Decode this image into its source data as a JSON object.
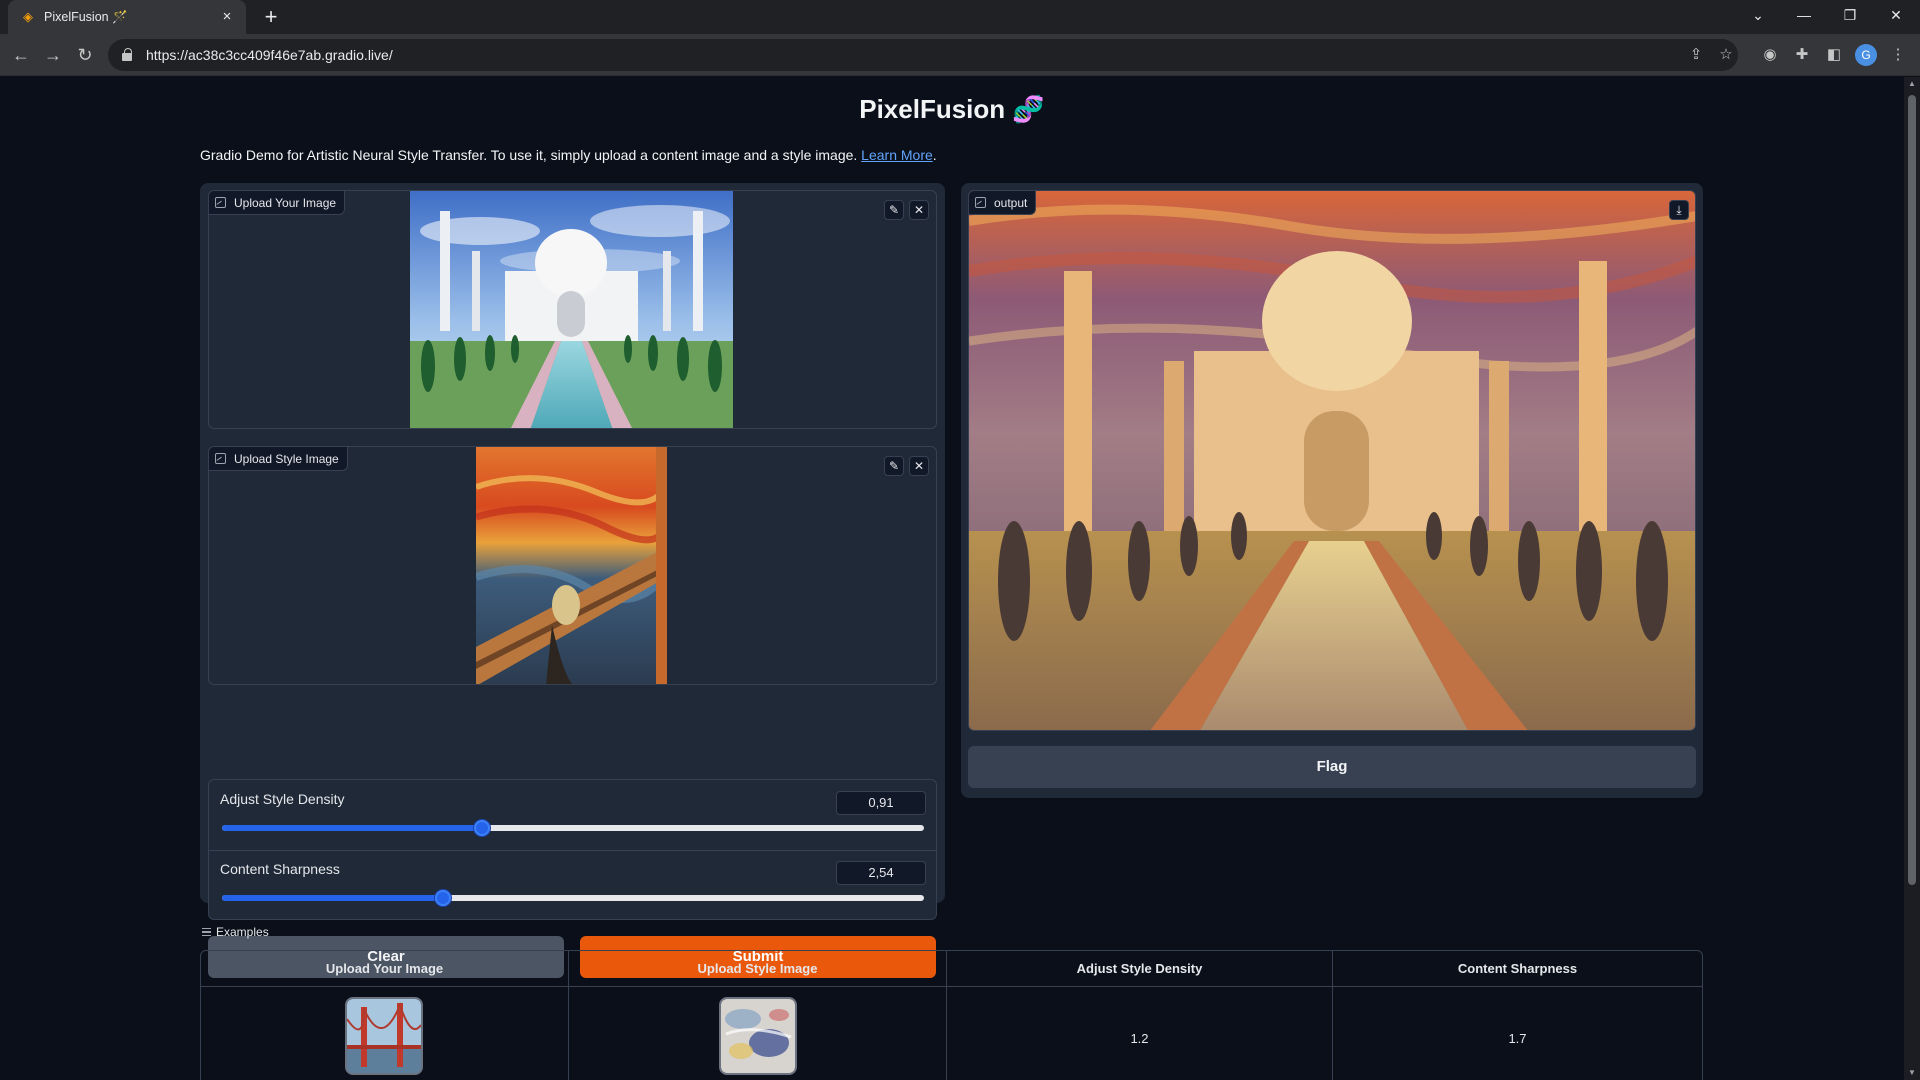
{
  "browser": {
    "tab_title": "PixelFusion 🪄",
    "url": "https://ac38c3cc409f46e7ab.gradio.live/",
    "new_tab_label": "+",
    "profile_initial": "G"
  },
  "page": {
    "title": "PixelFusion 🧬",
    "description": "Gradio Demo for Artistic Neural Style Transfer. To use it, simply upload a content image and a style image.",
    "learn_more": "Learn More",
    "period": "."
  },
  "inputs": {
    "content_image_label": "Upload Your Image",
    "style_image_label": "Upload Style Image",
    "edit_icon": "✎",
    "clear_icon": "✕"
  },
  "sliders": [
    {
      "label": "Adjust Style Density",
      "value": "0,91",
      "fraction": 0.37
    },
    {
      "label": "Content Sharpness",
      "value": "2,54",
      "fraction": 0.315
    }
  ],
  "buttons": {
    "clear": "Clear",
    "submit": "Submit",
    "flag": "Flag"
  },
  "output": {
    "label": "output",
    "download_icon": "⤓"
  },
  "examples": {
    "label": "Examples",
    "headers": [
      "Upload Your Image",
      "Upload Style Image",
      "Adjust Style Density",
      "Content Sharpness"
    ],
    "rows": [
      {
        "style_density": "1.2",
        "content_sharpness": "1.7"
      }
    ]
  },
  "colors": {
    "accent": "#ea580c",
    "slider": "#2563eb",
    "link": "#60a5fa",
    "background": "#0b0f19",
    "panel": "#1f2937"
  }
}
